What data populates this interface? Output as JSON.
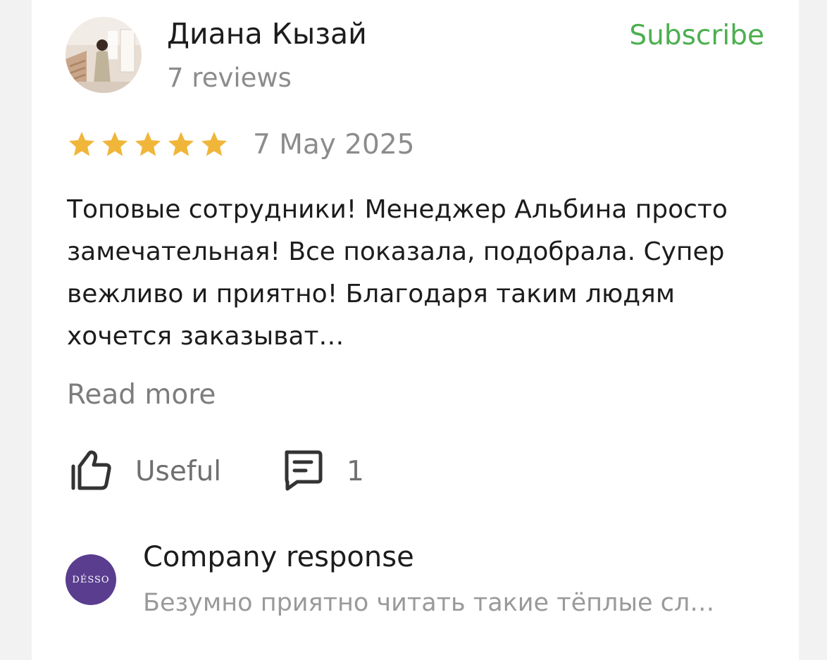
{
  "review": {
    "author_name": "Диана Кызай",
    "review_count": "7 reviews",
    "subscribe_label": "Subscribe",
    "rating": 5,
    "rating_max": 5,
    "date": "7 May 2025",
    "text": "Топовые сотрудники! Менеджер Альбина просто замечательная! Все показала, подобрала. Супер вежливо и приятно! Благодаря таким людям хочется заказыват…",
    "read_more_label": "Read more",
    "useful_label": "Useful",
    "comments_count": "1"
  },
  "company_response": {
    "logo_text": "DÉSSO",
    "title": "Company response",
    "text": "Безумно приятно читать такие тёплые сл…"
  },
  "colors": {
    "subscribe": "#4caf50",
    "star": "#f0b63a",
    "logo_bg": "#5a3d8f"
  },
  "icons": [
    "star-icon",
    "thumbs-up-icon",
    "comment-icon"
  ]
}
